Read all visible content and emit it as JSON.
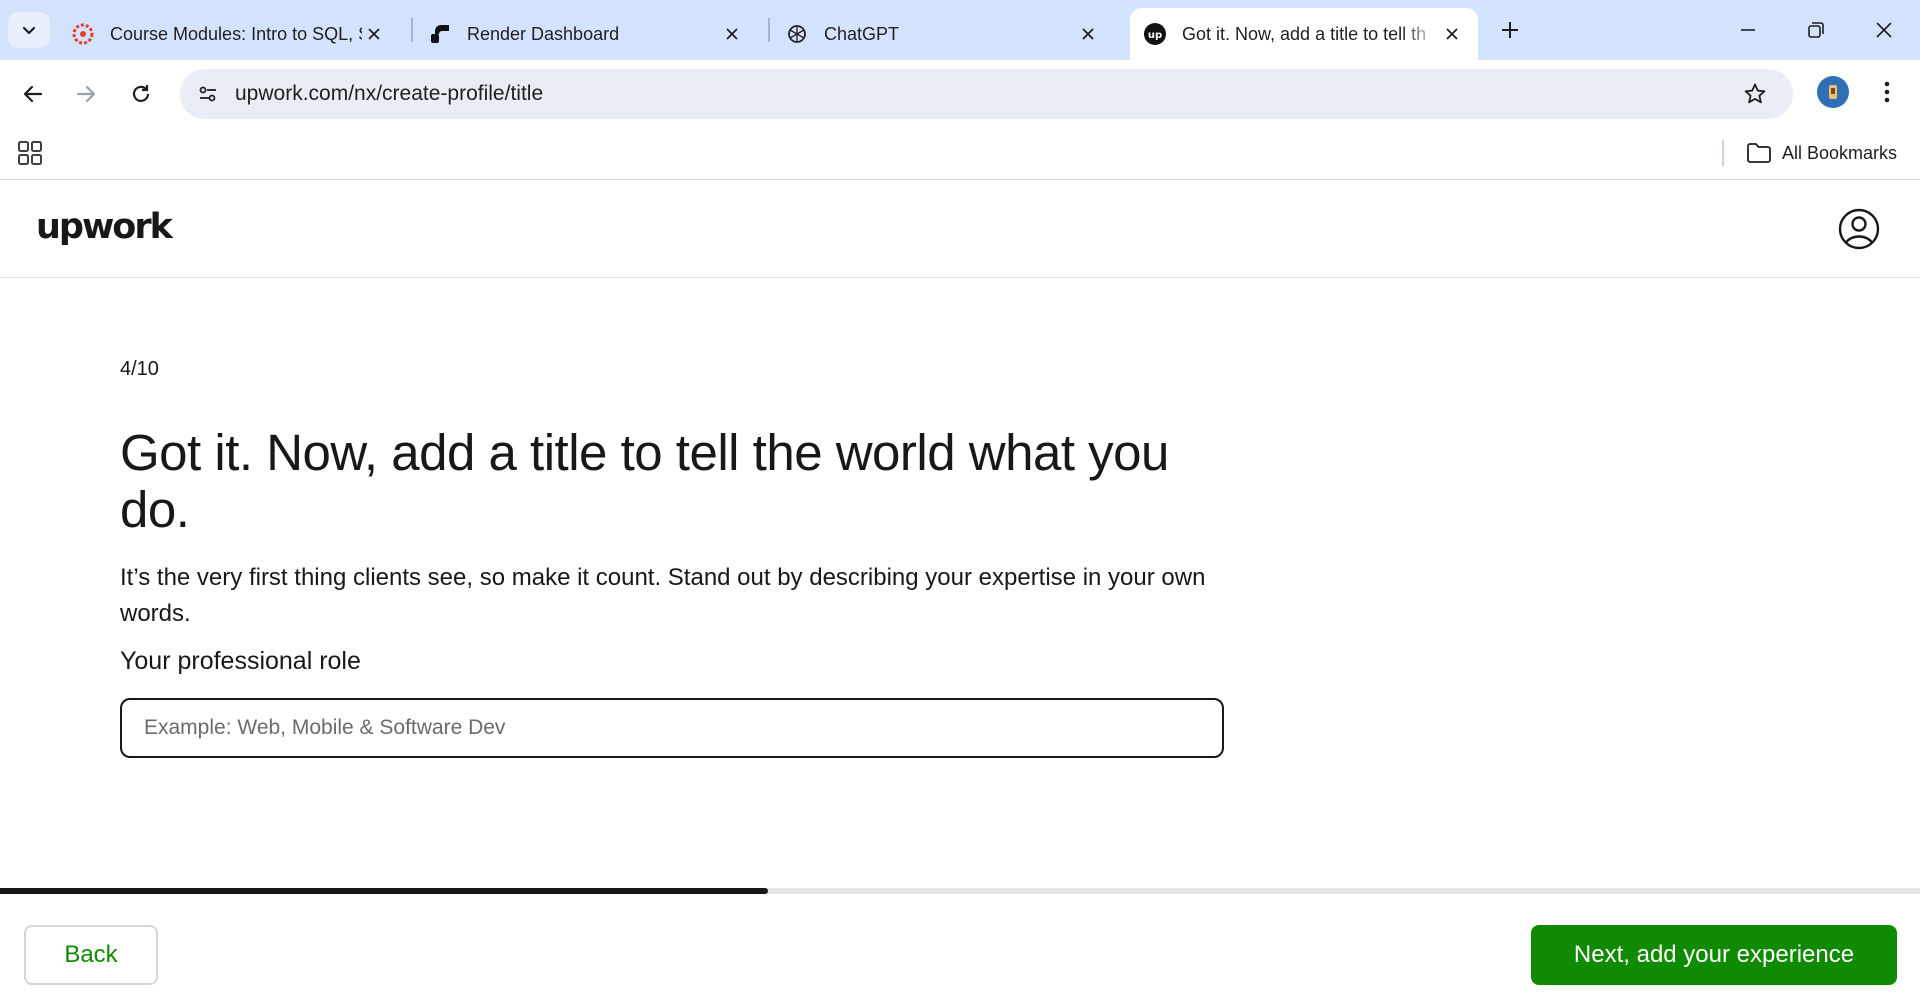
{
  "browser": {
    "tabs": [
      {
        "title": "Course Modules: Intro to SQL, S",
        "favicon": "canvas-icon",
        "active": false
      },
      {
        "title": "Render Dashboard",
        "favicon": "render-icon",
        "active": false
      },
      {
        "title": "ChatGPT",
        "favicon": "chatgpt-icon",
        "active": false
      },
      {
        "title": "Got it. Now, add a title to tell th",
        "favicon": "upwork-icon",
        "active": true
      }
    ],
    "url": "upwork.com/nx/create-profile/title",
    "bookmarks_label": "All Bookmarks"
  },
  "header": {
    "logo_text": "upwork"
  },
  "main": {
    "step": "4/10",
    "headline": "Got it. Now, add a title to tell the world what you do.",
    "subtext": "It’s the very first thing clients see, so make it count. Stand out by describing your expertise in your own words.",
    "field_label": "Your professional role",
    "role_input": {
      "value": "",
      "placeholder": "Example: Web, Mobile & Software Dev"
    }
  },
  "progress": {
    "fraction": 0.4
  },
  "footer": {
    "back_label": "Back",
    "next_label": "Next, add your experience"
  },
  "colors": {
    "accent_green": "#108a00",
    "text": "#181818",
    "tab_strip": "#d3e3fd"
  }
}
